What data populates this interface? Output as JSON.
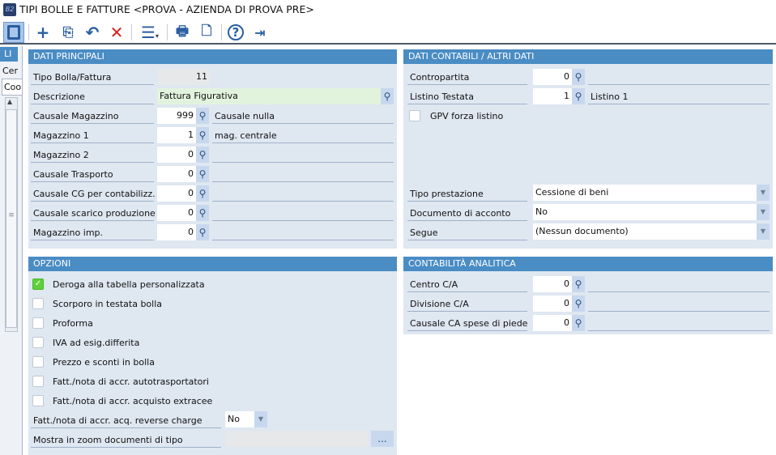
{
  "window": {
    "title": "TIPI BOLLE E FATTURE <PROVA - AZIENDA DI PROVA PRE>",
    "app_icon": "B2"
  },
  "toolbar": [
    {
      "name": "panel-toggle-button",
      "icon": "sidebar-icon"
    },
    {
      "name": "new-button",
      "icon": "plus-icon"
    },
    {
      "name": "copy-button",
      "icon": "copy-icon"
    },
    {
      "name": "undo-button",
      "icon": "undo-icon"
    },
    {
      "name": "delete-button",
      "icon": "close-icon"
    },
    {
      "name": "menu-button",
      "icon": "menu-icon"
    },
    {
      "name": "print-button",
      "icon": "printer-icon"
    },
    {
      "name": "print-preview-button",
      "icon": "preview-icon"
    },
    {
      "name": "help-button",
      "icon": "help-icon"
    },
    {
      "name": "exit-button",
      "icon": "exit-icon"
    }
  ],
  "sidebar": {
    "tab": "LI",
    "search_label": "Cer",
    "column": "Coo"
  },
  "dati_principali": {
    "header": "DATI PRINCIPALI",
    "tipo_label": "Tipo Bolla/Fattura",
    "tipo_value": "11",
    "descr_label": "Descrizione",
    "descr_value": "Fattura Figurativa",
    "rows": [
      {
        "label": "Causale Magazzino",
        "value": "999",
        "desc": "Causale nulla"
      },
      {
        "label": "Magazzino 1",
        "value": "1",
        "desc": "mag. centrale"
      },
      {
        "label": "Magazzino 2",
        "value": "0",
        "desc": ""
      },
      {
        "label": "Causale Trasporto",
        "value": "0",
        "desc": ""
      },
      {
        "label": "Causale CG per contabilizz.",
        "value": "0",
        "desc": ""
      },
      {
        "label": "Causale scarico produzione",
        "value": "0",
        "desc": ""
      },
      {
        "label": "Magazzino imp.",
        "value": "0",
        "desc": ""
      }
    ]
  },
  "dati_contabili": {
    "header": "DATI CONTABILI / ALTRI DATI",
    "rows": [
      {
        "label": "Contropartita",
        "value": "0",
        "desc": ""
      },
      {
        "label": "Listino Testata",
        "value": "1",
        "desc": "Listino 1"
      }
    ],
    "gpv_label": "GPV forza listino",
    "gpv_checked": false,
    "combos": [
      {
        "label": "Tipo prestazione",
        "value": "Cessione di beni"
      },
      {
        "label": "Documento di acconto",
        "value": "No"
      },
      {
        "label": "Segue",
        "value": "(Nessun documento)"
      }
    ]
  },
  "opzioni": {
    "header": "OPZIONI",
    "checks": [
      {
        "label": "Deroga alla tabella personalizzata",
        "checked": true
      },
      {
        "label": "Scorporo in testata bolla",
        "checked": false
      },
      {
        "label": "Proforma",
        "checked": false
      },
      {
        "label": "IVA ad esig.differita",
        "checked": false
      },
      {
        "label": "Prezzo e sconti in bolla",
        "checked": false
      },
      {
        "label": "Fatt./nota di accr. autotrasportatori",
        "checked": false
      },
      {
        "label": "Fatt./nota di accr. acquisto extracee",
        "checked": false
      }
    ],
    "reverse_label": "Fatt./nota di accr. acq. reverse charge",
    "reverse_value": "No",
    "mostra_label": "Mostra in zoom documenti di tipo",
    "mostra_value": "",
    "mostra_button": "..."
  },
  "analitica": {
    "header": "CONTABILITÀ ANALITICA",
    "rows": [
      {
        "label": "Centro C/A",
        "value": "0",
        "desc": ""
      },
      {
        "label": "Divisione C/A",
        "value": "0",
        "desc": ""
      },
      {
        "label": "Causale CA spese di piede",
        "value": "0",
        "desc": ""
      }
    ]
  },
  "colors": {
    "header": "#4a8cc4",
    "panel": "#dfe7f1",
    "check": "#5ed13a"
  }
}
